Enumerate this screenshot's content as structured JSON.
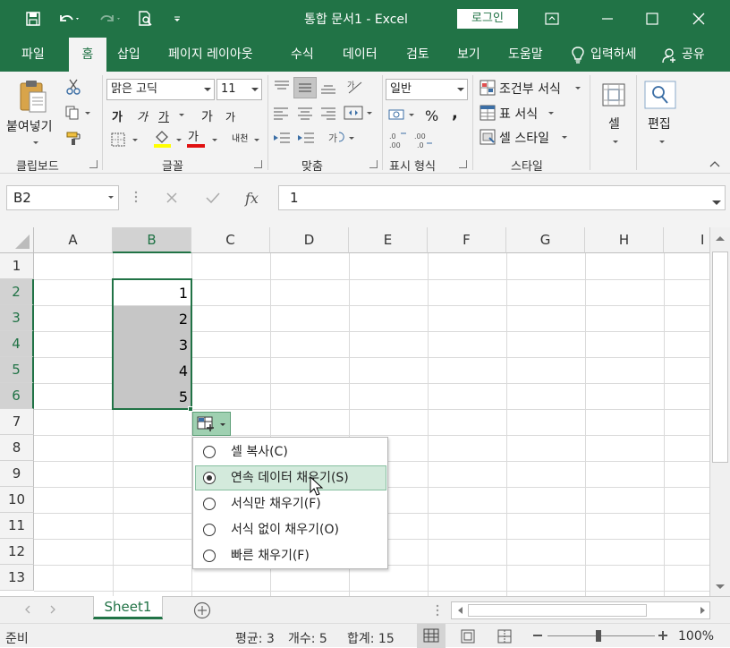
{
  "title_bar": {
    "title": "통합 문서1  -  Excel",
    "login": "로그인"
  },
  "tabs": [
    "파일",
    "홈",
    "삽입",
    "페이지 레이아웃",
    "수식",
    "데이터",
    "검토",
    "보기",
    "도움말"
  ],
  "tell_me": "입력하세",
  "share": "공유",
  "ribbon": {
    "clipboard": {
      "label": "클립보드",
      "paste": "붙여넣기"
    },
    "font": {
      "label": "글꼴",
      "font_name": "맑은 고딕",
      "font_size": "11",
      "bold": "가",
      "italic": "가",
      "underline": "가",
      "grow": "가",
      "shrink": "가",
      "font_color_glyph": "가",
      "phonetic": "내천"
    },
    "alignment": {
      "label": "맞춤"
    },
    "number": {
      "label": "표시 형식",
      "format": "일반",
      "percent": "%",
      "comma": ","
    },
    "styles": {
      "label": "스타일",
      "conditional": "조건부 서식",
      "table": "표 서식",
      "cell_styles": "셀 스타일"
    },
    "cells": {
      "label": "셀"
    },
    "editing": {
      "label": "편집"
    }
  },
  "formula_bar": {
    "name_box": "B2",
    "fx": "fx",
    "value": "1"
  },
  "sheet": {
    "columns": [
      "A",
      "B",
      "C",
      "D",
      "E",
      "F",
      "G",
      "H",
      "I"
    ],
    "rows": [
      "1",
      "2",
      "3",
      "4",
      "5",
      "6",
      "7",
      "8",
      "9",
      "10",
      "11",
      "12",
      "13"
    ],
    "b_values": [
      "1",
      "2",
      "3",
      "4",
      "5"
    ]
  },
  "fill_menu": {
    "items": [
      "셀 복사(C)",
      "연속 데이터 채우기(S)",
      "서식만 채우기(F)",
      "서식 없이 채우기(O)",
      "빠른 채우기(F)"
    ],
    "selected_index": 1
  },
  "sheet_tabs": {
    "active": "Sheet1"
  },
  "status_bar": {
    "mode": "준비",
    "average": "평균: 3",
    "count": "개수: 5",
    "sum": "합계: 15",
    "zoom": "100%"
  },
  "colors": {
    "accent": "#217346",
    "selection_fill": "#c6c6c6"
  }
}
